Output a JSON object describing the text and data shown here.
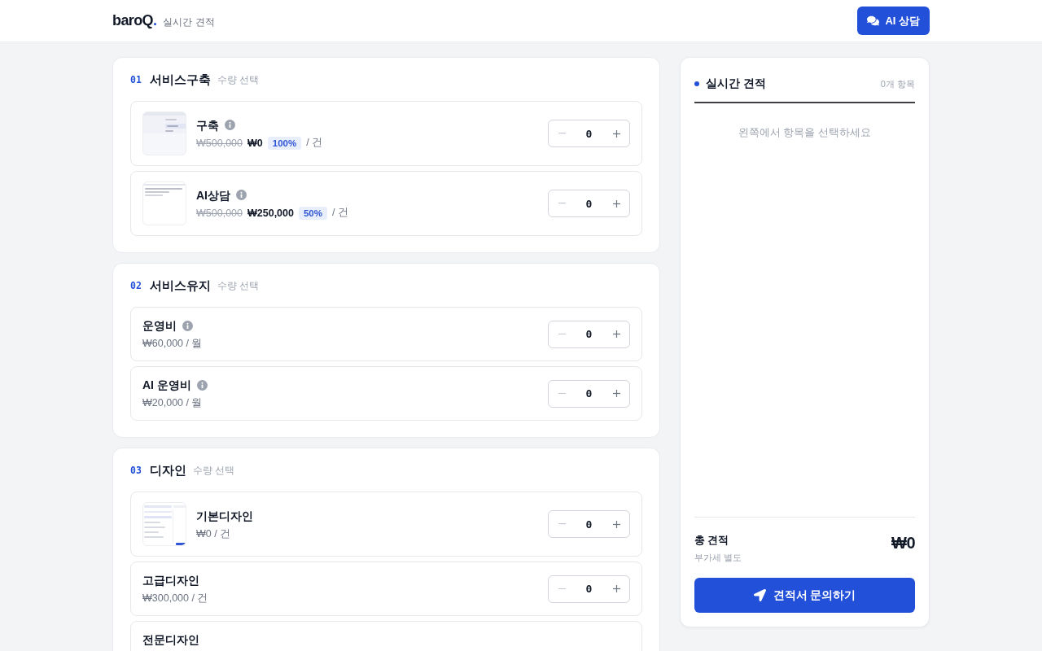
{
  "header": {
    "logo": "baroQ",
    "logo_dot": ".",
    "subtitle": "실시간 견적",
    "ai_button": "AI 상담"
  },
  "sections": [
    {
      "number": "01",
      "title": "서비스구축",
      "hint": "수량 선택",
      "items": [
        {
          "kind": "menu",
          "name": "구축",
          "info": true,
          "original_price": "₩500,000",
          "price": "₩0",
          "discount": "100%",
          "unit": "/ 건",
          "quantity": "0"
        },
        {
          "kind": "chat",
          "name": "AI상담",
          "info": true,
          "original_price": "₩500,000",
          "price": "₩250,000",
          "discount": "50%",
          "unit": "/ 건",
          "quantity": "0"
        }
      ]
    },
    {
      "number": "02",
      "title": "서비스유지",
      "hint": "수량 선택",
      "items": [
        {
          "kind": "plain",
          "name": "운영비",
          "info": true,
          "price": "₩60,000 / 월",
          "quantity": "0"
        },
        {
          "kind": "plain",
          "name": "AI 운영비",
          "info": true,
          "price": "₩20,000 / 월",
          "quantity": "0"
        }
      ]
    },
    {
      "number": "03",
      "title": "디자인",
      "hint": "수량 선택",
      "items": [
        {
          "kind": "grid",
          "name": "기본디자인",
          "info": false,
          "price": "₩0 / 건",
          "quantity": "0"
        },
        {
          "kind": "plain",
          "name": "고급디자인",
          "info": false,
          "price": "₩300,000 / 건",
          "quantity": "0"
        },
        {
          "kind": "plain",
          "name": "전문디자인",
          "info": false
        }
      ]
    }
  ],
  "summary": {
    "title": "실시간 견적",
    "count": "0개 항목",
    "empty_message": "왼쪽에서 항목을 선택하세요",
    "total_label": "총 견적",
    "vat_note": "부가세 별도",
    "total": "₩0",
    "submit": "견적서 문의하기"
  }
}
